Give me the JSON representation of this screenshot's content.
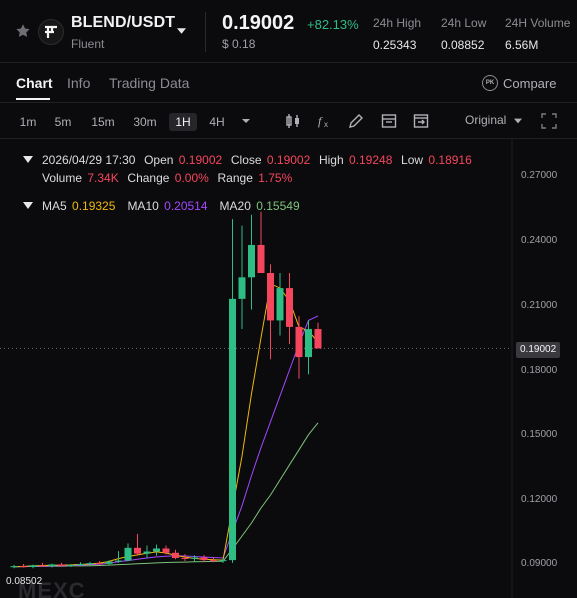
{
  "header": {
    "pair": "BLEND/USDT",
    "subtitle": "Fluent",
    "price": "0.19002",
    "change_pct": "+82.13%",
    "usd_price": "$ 0.18",
    "stats": [
      {
        "label": "24h High",
        "value": "0.25343"
      },
      {
        "label": "24h Low",
        "value": "0.08852"
      },
      {
        "label": "24H Volume",
        "value": "6.56M"
      }
    ],
    "logo_text": "F",
    "icons": {
      "favorite": "star-icon",
      "dropdown": "chevron-down-icon"
    }
  },
  "tabs": [
    {
      "label": "Chart",
      "active": true
    },
    {
      "label": "Info",
      "active": false
    },
    {
      "label": "Trading Data",
      "active": false
    }
  ],
  "compare": {
    "label": "Compare",
    "badge": "PK"
  },
  "toolbar": {
    "timeframes": [
      "1m",
      "5m",
      "15m",
      "30m",
      "1H",
      "4H"
    ],
    "active_timeframe": "1H",
    "original_label": "Original",
    "tools": [
      "candle-type-icon",
      "indicator-fx-icon",
      "draw-pen-icon",
      "settings-panel-icon",
      "save-image-icon",
      "fullscreen-icon"
    ]
  },
  "ohlc": {
    "datetime": "2026/04/29 17:30",
    "open_label": "Open",
    "open": "0.19002",
    "close_label": "Close",
    "close": "0.19002",
    "high_label": "High",
    "high": "0.19248",
    "low_label": "Low",
    "low": "0.18916",
    "volume_label": "Volume",
    "volume": "7.34K",
    "change_label": "Change",
    "change": "0.00%",
    "range_label": "Range",
    "range": "1.75%"
  },
  "ma": {
    "ma5_label": "MA5",
    "ma5": "0.19325",
    "ma10_label": "MA10",
    "ma10": "0.20514",
    "ma20_label": "MA20",
    "ma20": "0.15549"
  },
  "axis": {
    "ticks": [
      "0.27000",
      "0.24000",
      "0.21000",
      "0.18000",
      "0.15000",
      "0.12000",
      "0.09000"
    ],
    "current_price_tag": "0.19002",
    "min_low_tag": "0.08502"
  },
  "watermark": "MEXC",
  "colors": {
    "up": "#2ebd85",
    "down": "#f6465d",
    "ma5": "#f0b90b",
    "ma10": "#a347ff",
    "ma20": "#7ec27b"
  },
  "chart_data": {
    "type": "candlestick",
    "ylim": [
      0.085,
      0.28
    ],
    "candles": [
      {
        "o": 0.0885,
        "h": 0.0896,
        "l": 0.088,
        "c": 0.089
      },
      {
        "o": 0.089,
        "h": 0.09,
        "l": 0.0884,
        "c": 0.0886
      },
      {
        "o": 0.0886,
        "h": 0.0897,
        "l": 0.088,
        "c": 0.0894
      },
      {
        "o": 0.0894,
        "h": 0.0905,
        "l": 0.0888,
        "c": 0.089
      },
      {
        "o": 0.089,
        "h": 0.0902,
        "l": 0.0884,
        "c": 0.0898
      },
      {
        "o": 0.0898,
        "h": 0.0906,
        "l": 0.0888,
        "c": 0.0892
      },
      {
        "o": 0.0892,
        "h": 0.09,
        "l": 0.0886,
        "c": 0.0896
      },
      {
        "o": 0.0896,
        "h": 0.0908,
        "l": 0.089,
        "c": 0.09
      },
      {
        "o": 0.09,
        "h": 0.091,
        "l": 0.0894,
        "c": 0.0904
      },
      {
        "o": 0.0904,
        "h": 0.0914,
        "l": 0.0898,
        "c": 0.0901
      },
      {
        "o": 0.0901,
        "h": 0.0917,
        "l": 0.0896,
        "c": 0.0911
      },
      {
        "o": 0.0911,
        "h": 0.096,
        "l": 0.0905,
        "c": 0.0916
      },
      {
        "o": 0.0916,
        "h": 0.0995,
        "l": 0.0912,
        "c": 0.0975
      },
      {
        "o": 0.0975,
        "h": 0.104,
        "l": 0.0938,
        "c": 0.0948
      },
      {
        "o": 0.0948,
        "h": 0.0986,
        "l": 0.093,
        "c": 0.0958
      },
      {
        "o": 0.0958,
        "h": 0.099,
        "l": 0.0938,
        "c": 0.0972
      },
      {
        "o": 0.0972,
        "h": 0.0986,
        "l": 0.0944,
        "c": 0.0952
      },
      {
        "o": 0.0952,
        "h": 0.0966,
        "l": 0.0922,
        "c": 0.0928
      },
      {
        "o": 0.0928,
        "h": 0.0946,
        "l": 0.0914,
        "c": 0.0924
      },
      {
        "o": 0.0924,
        "h": 0.094,
        "l": 0.0912,
        "c": 0.093
      },
      {
        "o": 0.093,
        "h": 0.0942,
        "l": 0.091,
        "c": 0.0918
      },
      {
        "o": 0.0918,
        "h": 0.093,
        "l": 0.0908,
        "c": 0.0914
      },
      {
        "o": 0.0914,
        "h": 0.0926,
        "l": 0.0905,
        "c": 0.0918
      },
      {
        "o": 0.0918,
        "h": 0.25,
        "l": 0.0905,
        "c": 0.213
      },
      {
        "o": 0.213,
        "h": 0.247,
        "l": 0.199,
        "c": 0.223
      },
      {
        "o": 0.223,
        "h": 0.252,
        "l": 0.208,
        "c": 0.238
      },
      {
        "o": 0.238,
        "h": 0.2534,
        "l": 0.226,
        "c": 0.225
      },
      {
        "o": 0.225,
        "h": 0.229,
        "l": 0.185,
        "c": 0.203
      },
      {
        "o": 0.203,
        "h": 0.225,
        "l": 0.196,
        "c": 0.218
      },
      {
        "o": 0.218,
        "h": 0.225,
        "l": 0.192,
        "c": 0.2
      },
      {
        "o": 0.2,
        "h": 0.205,
        "l": 0.176,
        "c": 0.186
      },
      {
        "o": 0.186,
        "h": 0.203,
        "l": 0.178,
        "c": 0.199
      },
      {
        "o": 0.199,
        "h": 0.202,
        "l": 0.19,
        "c": 0.19
      }
    ],
    "ma5": [
      0.0887,
      0.0889,
      0.0891,
      0.0893,
      0.0894,
      0.0895,
      0.0896,
      0.0898,
      0.09,
      0.0904,
      0.0912,
      0.0925,
      0.0935,
      0.0942,
      0.095,
      0.0956,
      0.0951,
      0.094,
      0.0932,
      0.0926,
      0.0922,
      0.092,
      0.0918,
      0.116,
      0.14,
      0.169,
      0.195,
      0.22,
      0.218,
      0.212,
      0.2,
      0.198,
      0.193
    ],
    "ma10": [
      0.0887,
      0.0888,
      0.0889,
      0.089,
      0.0891,
      0.0892,
      0.0893,
      0.0895,
      0.0897,
      0.0899,
      0.0904,
      0.091,
      0.0916,
      0.0922,
      0.0928,
      0.0933,
      0.0936,
      0.0938,
      0.0937,
      0.0935,
      0.0932,
      0.093,
      0.0928,
      0.105,
      0.117,
      0.131,
      0.144,
      0.156,
      0.168,
      0.18,
      0.192,
      0.203,
      0.2051
    ],
    "ma20": [
      0.0888,
      0.0888,
      0.0889,
      0.0889,
      0.089,
      0.089,
      0.0891,
      0.0891,
      0.0892,
      0.0893,
      0.0895,
      0.0897,
      0.0899,
      0.0901,
      0.0903,
      0.0905,
      0.0907,
      0.0908,
      0.0909,
      0.091,
      0.0911,
      0.0912,
      0.0913,
      0.097,
      0.103,
      0.109,
      0.116,
      0.122,
      0.129,
      0.136,
      0.143,
      0.15,
      0.1555
    ],
    "current_price": 0.19002
  }
}
